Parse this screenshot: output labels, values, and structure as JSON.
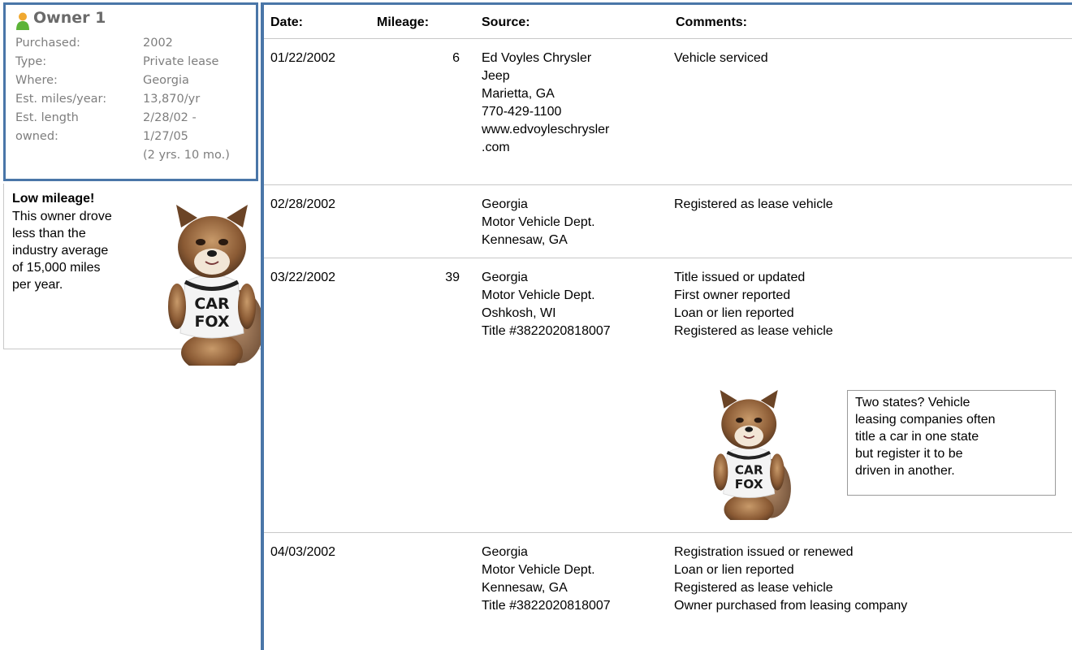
{
  "owner": {
    "title": "Owner 1",
    "details": [
      {
        "label": "Purchased:",
        "value": "2002"
      },
      {
        "label": "Type:",
        "value": "Private lease"
      },
      {
        "label": "Where:",
        "value": "Georgia"
      },
      {
        "label": "Est. miles/year:",
        "value": "13,870/yr"
      },
      {
        "label": "Est. length",
        "value": "2/28/02 -"
      },
      {
        "label": "owned:",
        "value": "1/27/05"
      },
      {
        "label": "",
        "value": "(2 yrs. 10 mo.)"
      }
    ],
    "icon": "person-icon"
  },
  "tip": {
    "title": "Low mileage!",
    "lines": [
      "This owner drove",
      "less than the",
      "industry average",
      "of 15,000 miles",
      "per year."
    ],
    "mascot_shirt": [
      "CAR",
      "FOX"
    ]
  },
  "table": {
    "headers": {
      "date": "Date:",
      "mileage": "Mileage:",
      "source": "Source:",
      "comments": "Comments:"
    },
    "rows": [
      {
        "date": "01/22/2002",
        "mileage": "6",
        "source": [
          "Ed Voyles Chrysler",
          "Jeep",
          "Marietta, GA",
          "770-429-1100",
          "www.edvoyleschrysler",
          ".com"
        ],
        "comments": [
          "Vehicle serviced"
        ]
      },
      {
        "date": "02/28/2002",
        "mileage": "",
        "source": [
          "Georgia",
          "Motor Vehicle Dept.",
          "Kennesaw, GA"
        ],
        "comments": [
          "Registered as lease vehicle"
        ]
      },
      {
        "date": "03/22/2002",
        "mileage": "39",
        "source": [
          "Georgia",
          "Motor Vehicle Dept.",
          "Oshkosh, WI",
          "Title #3822020818007"
        ],
        "comments": [
          "Title issued or updated",
          "First owner reported",
          "Loan or lien reported",
          "Registered as lease vehicle"
        ]
      },
      {
        "date": "04/03/2002",
        "mileage": "",
        "source": [
          "Georgia",
          "Motor Vehicle Dept.",
          "Kennesaw, GA",
          "Title #3822020818007"
        ],
        "comments": [
          "Registration issued or renewed",
          "Loan or lien reported",
          "Registered as lease vehicle",
          "Owner purchased from leasing company"
        ]
      }
    ]
  },
  "note": {
    "lines": [
      "Two states? Vehicle",
      "leasing companies often",
      "title a car in one state",
      "but register it to be",
      "driven in another."
    ]
  },
  "colors": {
    "accent": "#4a76a8",
    "rule": "#c8c8c8",
    "muted_text": "#7e7e7e"
  }
}
